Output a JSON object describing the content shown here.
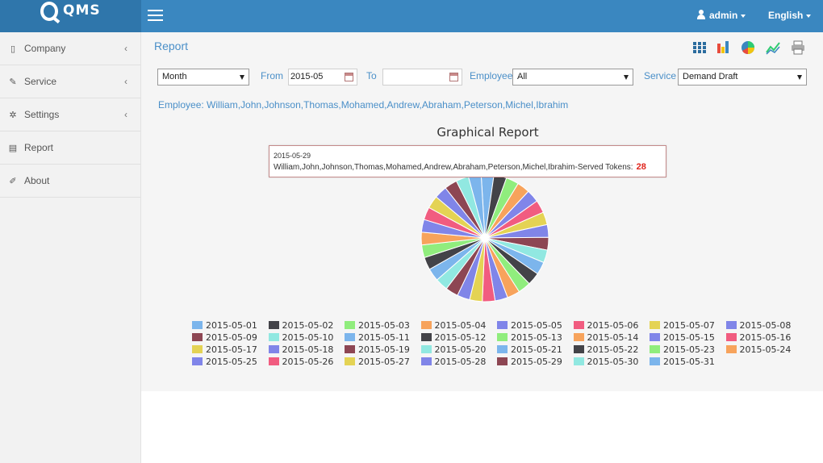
{
  "app": {
    "logo_text": "QMS"
  },
  "header": {
    "user": "admin",
    "language": "English"
  },
  "sidebar": {
    "items": [
      {
        "label": "Company",
        "icon": "building-icon",
        "has_chevron": true
      },
      {
        "label": "Service",
        "icon": "wrench-icon",
        "has_chevron": true
      },
      {
        "label": "Settings",
        "icon": "gear-icon",
        "has_chevron": true
      },
      {
        "label": "Report",
        "icon": "file-icon",
        "has_chevron": false
      },
      {
        "label": "About",
        "icon": "edit-icon",
        "has_chevron": false
      }
    ]
  },
  "page": {
    "title": "Report"
  },
  "toolbar": {
    "icons": [
      "table-view-icon",
      "bar-chart-icon",
      "pie-chart-icon",
      "line-chart-icon",
      "print-icon"
    ]
  },
  "filters": {
    "period": "Month",
    "from_label": "From",
    "from_value": "2015-05",
    "to_label": "To",
    "to_value": "",
    "employee_label": "Employee",
    "employee_value": "All",
    "service_label": "Service",
    "service_value": "Demand Draft"
  },
  "employee_line": "Employee: William,John,Johnson,Thomas,Mohamed,Andrew,Abraham,Peterson,Michel,Ibrahim",
  "tooltip": {
    "date": "2015-05-29",
    "text": "William,John,Johnson,Thomas,Mohamed,Andrew,Abraham,Peterson,Michel,Ibrahim-Served Tokens:",
    "value": "28"
  },
  "chart_data": {
    "type": "pie",
    "title": "Graphical Report",
    "legend_position": "bottom",
    "categories": [
      "2015-05-01",
      "2015-05-02",
      "2015-05-03",
      "2015-05-04",
      "2015-05-05",
      "2015-05-06",
      "2015-05-07",
      "2015-05-08",
      "2015-05-09",
      "2015-05-10",
      "2015-05-11",
      "2015-05-12",
      "2015-05-13",
      "2015-05-14",
      "2015-05-15",
      "2015-05-16",
      "2015-05-17",
      "2015-05-18",
      "2015-05-19",
      "2015-05-20",
      "2015-05-21",
      "2015-05-22",
      "2015-05-23",
      "2015-05-24",
      "2015-05-25",
      "2015-05-26",
      "2015-05-27",
      "2015-05-28",
      "2015-05-29",
      "2015-05-30",
      "2015-05-31"
    ],
    "values": [
      28,
      28,
      28,
      28,
      28,
      28,
      28,
      28,
      28,
      28,
      28,
      28,
      28,
      28,
      28,
      28,
      28,
      28,
      28,
      28,
      28,
      28,
      28,
      28,
      28,
      28,
      28,
      28,
      28,
      28,
      28
    ],
    "colors": [
      "#7cb5ec",
      "#434348",
      "#90ed7d",
      "#f7a35c",
      "#8085e9",
      "#f15c80",
      "#e4d354",
      "#8085e8",
      "#8d4653",
      "#91e8e1",
      "#7cb5ec",
      "#434348",
      "#90ed7d",
      "#f7a35c",
      "#8085e9",
      "#f15c80",
      "#e4d354",
      "#8085e8",
      "#8d4653",
      "#91e8e1",
      "#7cb5ec",
      "#434348",
      "#90ed7d",
      "#f7a35c",
      "#8085e9",
      "#f15c80",
      "#e4d354",
      "#8085e8",
      "#8d4653",
      "#91e8e1",
      "#7cb5ec"
    ]
  }
}
